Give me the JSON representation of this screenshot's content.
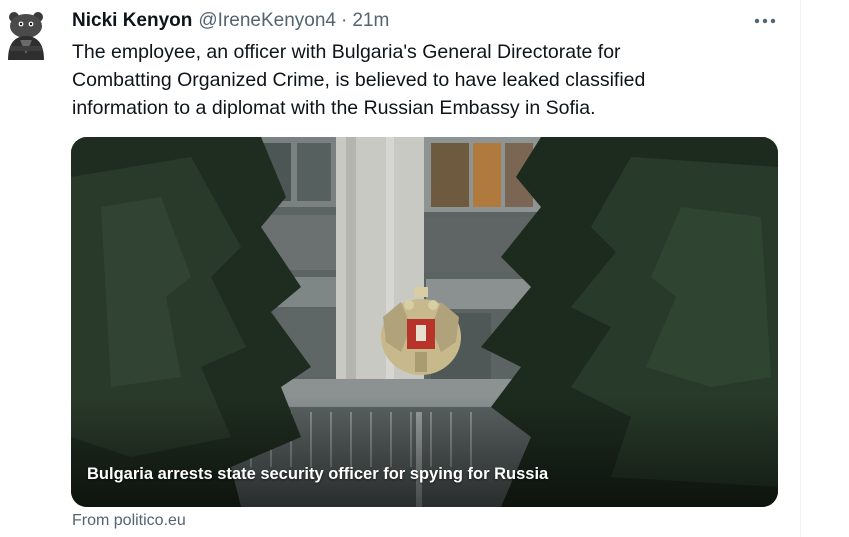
{
  "tweet": {
    "author_name": "Nicki Kenyon",
    "author_handle": "@IreneKenyon4",
    "separator": "·",
    "time": "21m",
    "text_lines": [
      "The employee, an officer with Bulgaria's General Directorate for",
      "Combatting Organized Crime, is believed to have leaked classified",
      "information to a diplomat with the Russian Embassy in Sofia."
    ]
  },
  "card": {
    "caption": "Bulgaria arrests state security officer for spying for Russia",
    "source": "From politico.eu"
  },
  "icons": {
    "more": "more-horizontal-icon",
    "avatar": "avatar-image",
    "coat_of_arms": "double-headed-eagle-emblem"
  },
  "colors": {
    "text_primary": "#0f1419",
    "text_secondary": "#536471",
    "divider": "#eff3f4"
  }
}
